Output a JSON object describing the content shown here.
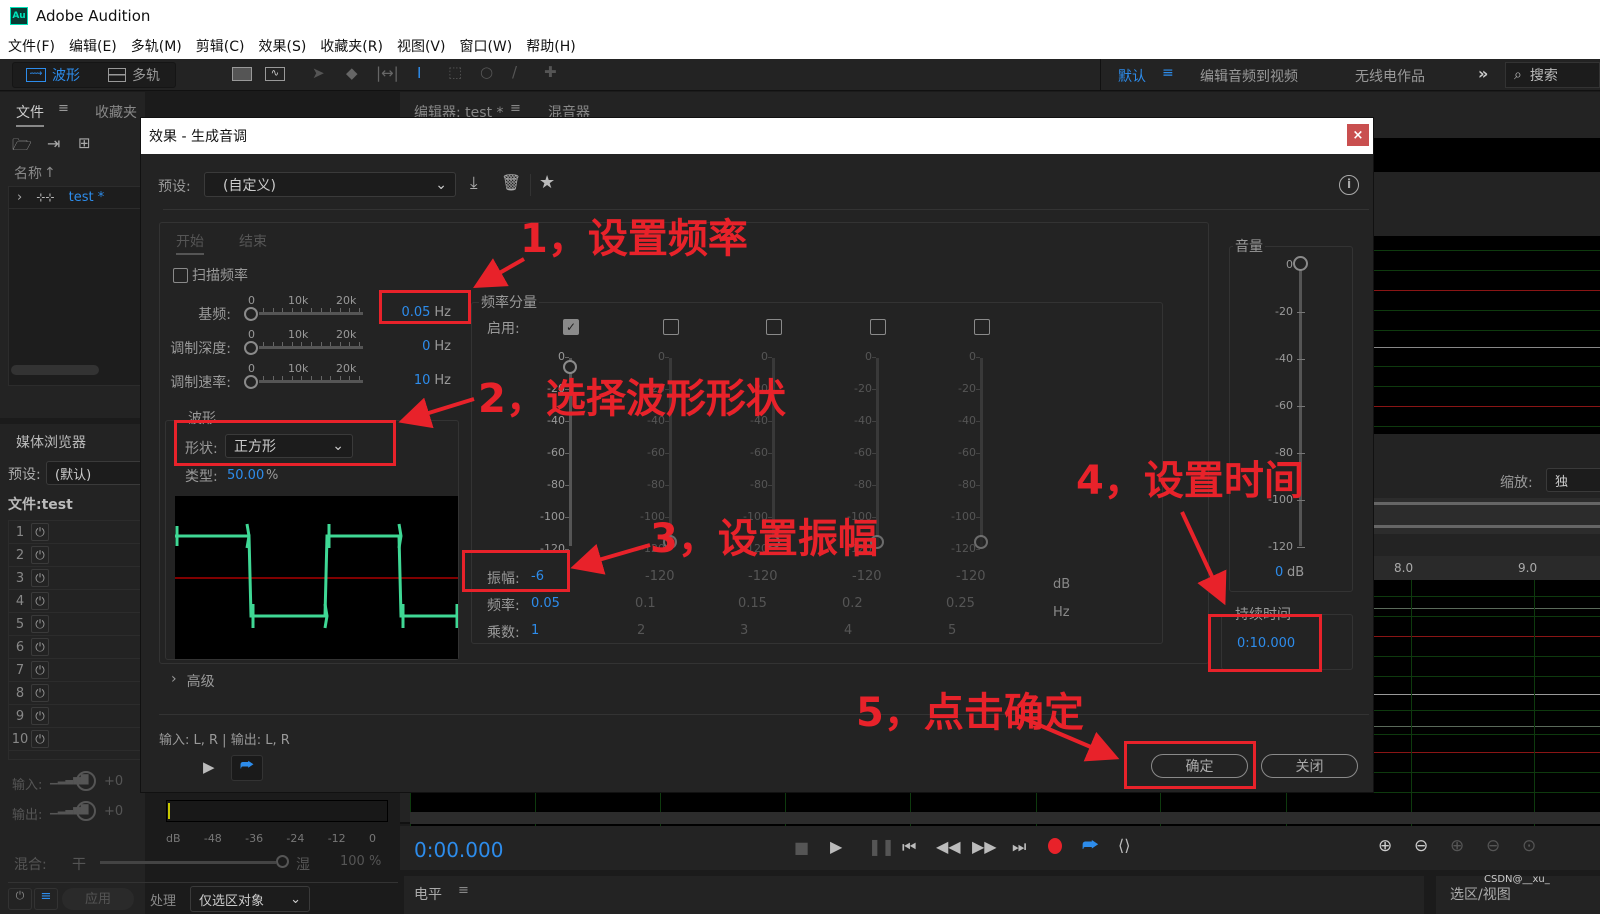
{
  "app": {
    "title": "Adobe Audition",
    "logo": "Au"
  },
  "menu": [
    "文件(F)",
    "编辑(E)",
    "多轨(M)",
    "剪辑(C)",
    "效果(S)",
    "收藏夹(R)",
    "视图(V)",
    "窗口(W)",
    "帮助(H)"
  ],
  "toolbar": {
    "waveform": "波形",
    "multitrack": "多轨",
    "workspace_default": "默认",
    "workspace_items": [
      "编辑音频到视频",
      "无线电作品"
    ],
    "search_placeholder": "搜索"
  },
  "files_panel": {
    "tab_files": "文件",
    "tab_favorites": "收藏夹",
    "col_name": "名称",
    "file": "test *"
  },
  "editor": {
    "tab_editor": "编辑器: test *",
    "tab_mixer": "混音器",
    "zoom_label": "缩放:",
    "zoom_value": "独",
    "ruler": [
      "8.0",
      "9.0"
    ],
    "time": "0:00.000"
  },
  "media": {
    "title": "媒体浏览器",
    "preset_label": "预设:",
    "preset_value": "(默认)",
    "file_label": "文件:test",
    "tracks": [
      "1",
      "2",
      "3",
      "4",
      "5",
      "6",
      "7",
      "8",
      "9",
      "10"
    ],
    "input_label": "输入:",
    "output_label": "输出:",
    "input_gain": "+0",
    "output_gain": "+0",
    "meter_ticks": [
      "dB",
      "-48",
      "-36",
      "-24",
      "-12",
      "0"
    ],
    "mix_label": "混合:",
    "dry": "干",
    "wet": "湿",
    "mix_pct": "100 %",
    "apply": "应用",
    "process_label": "处理",
    "process_value": "仅选区对象"
  },
  "bottom": {
    "levels": "电平",
    "selection": "选区/视图",
    "watermark": "CSDN@__xu_"
  },
  "dialog": {
    "title": "效果 - 生成音调",
    "preset_label": "预设:",
    "preset_value": "(自定义)",
    "tab_start": "开始",
    "tab_end": "结束",
    "sweep_label": "扫描频率",
    "slider_ticks": [
      "0",
      "10k",
      "20k"
    ],
    "base_freq_label": "基频:",
    "base_freq_value": "0.05",
    "unit_hz": "Hz",
    "mod_depth_label": "调制深度:",
    "mod_depth_value": "0",
    "mod_rate_label": "调制速率:",
    "mod_rate_value": "10",
    "waveform_group": "波形",
    "shape_label": "形状:",
    "shape_value": "正方形",
    "type_label": "类型:",
    "type_value": "50.00",
    "type_unit": "%",
    "components_group": "频率分量",
    "enable_label": "启用:",
    "db_ticks": [
      "0",
      "-20",
      "-40",
      "-60",
      "-80",
      "-100",
      "-120"
    ],
    "amp_label": "振幅:",
    "freq_label": "频率:",
    "mult_label": "乘数:",
    "components": [
      {
        "enabled": true,
        "amp": "-6",
        "freq": "0.05",
        "mult": "1"
      },
      {
        "enabled": false,
        "amp": "-120",
        "freq": "0.1",
        "mult": "2"
      },
      {
        "enabled": false,
        "amp": "-120",
        "freq": "0.15",
        "mult": "3"
      },
      {
        "enabled": false,
        "amp": "-120",
        "freq": "0.2",
        "mult": "4"
      },
      {
        "enabled": false,
        "amp": "-120",
        "freq": "0.25",
        "mult": "5"
      }
    ],
    "unit_db": "dB",
    "volume_group": "音量",
    "volume_ticks": [
      "0",
      "-20",
      "-40",
      "-60",
      "-80",
      "-100",
      "-120"
    ],
    "volume_value": "0",
    "volume_unit": "dB",
    "duration_group": "持续时间",
    "duration_value": "0:10.000",
    "advanced": "高级",
    "io": "输入: L, R | 输出: L, R",
    "ok": "确定",
    "close": "关闭"
  },
  "annotations": [
    "1，设置频率",
    "2，选择波形形状",
    "3，设置振幅",
    "4，设置时间",
    "5，点击确定"
  ]
}
